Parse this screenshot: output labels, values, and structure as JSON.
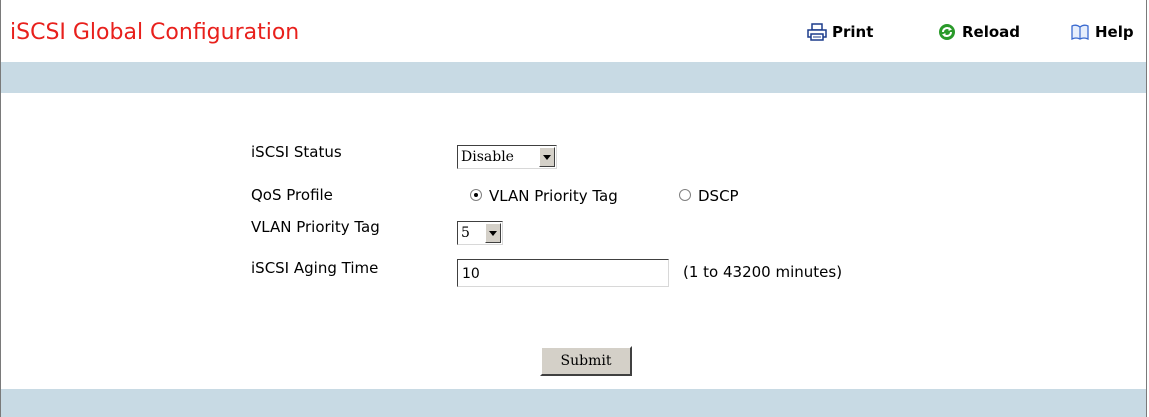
{
  "header": {
    "title": "iSCSI Global Configuration",
    "print_label": "Print",
    "reload_label": "Reload",
    "help_label": "Help"
  },
  "form": {
    "status_label": "iSCSI Status",
    "status_value": "Disable",
    "qos_label": "QoS Profile",
    "qos_option_vlan": "VLAN Priority Tag",
    "qos_option_dscp": "DSCP",
    "qos_selected": "VLAN Priority Tag",
    "vlan_tag_label": "VLAN Priority Tag",
    "vlan_tag_value": "5",
    "aging_label": "iSCSI Aging Time",
    "aging_value": "10",
    "aging_hint": "(1 to 43200 minutes)",
    "submit_label": "Submit"
  },
  "colors": {
    "title": "#e8201c",
    "band": "#c8dae4",
    "reload_icon": "#2a9a2a",
    "print_icon": "#1c3c8c",
    "help_icon": "#3a6ad0"
  },
  "icons": {
    "print": "printer-icon",
    "reload": "reload-icon",
    "help": "help-book-icon"
  }
}
